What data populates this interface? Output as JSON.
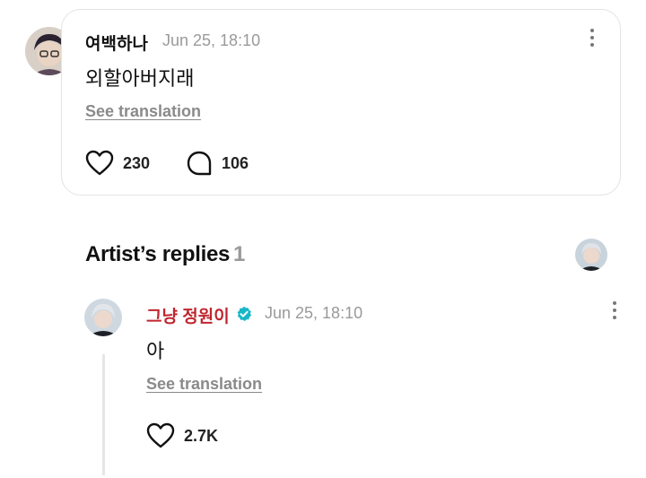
{
  "post": {
    "author": "여백하나",
    "time": "Jun 25, 18:10",
    "text": "외할아버지래",
    "translate_label": "See translation",
    "likes": "230",
    "comments": "106"
  },
  "replies_section": {
    "title": "Artist’s replies",
    "count": "1"
  },
  "reply": {
    "author": "그냥 정원이",
    "time": "Jun 25, 18:10",
    "text": "아",
    "translate_label": "See translation",
    "likes": "2.7K"
  },
  "colors": {
    "artist_name": "#c0262f",
    "verified_badge": "#16b8c6",
    "muted_text": "#9a9a9a"
  },
  "icons": [
    "heart-icon",
    "comment-bubble-icon",
    "more-vertical-icon",
    "verified-badge-icon"
  ]
}
